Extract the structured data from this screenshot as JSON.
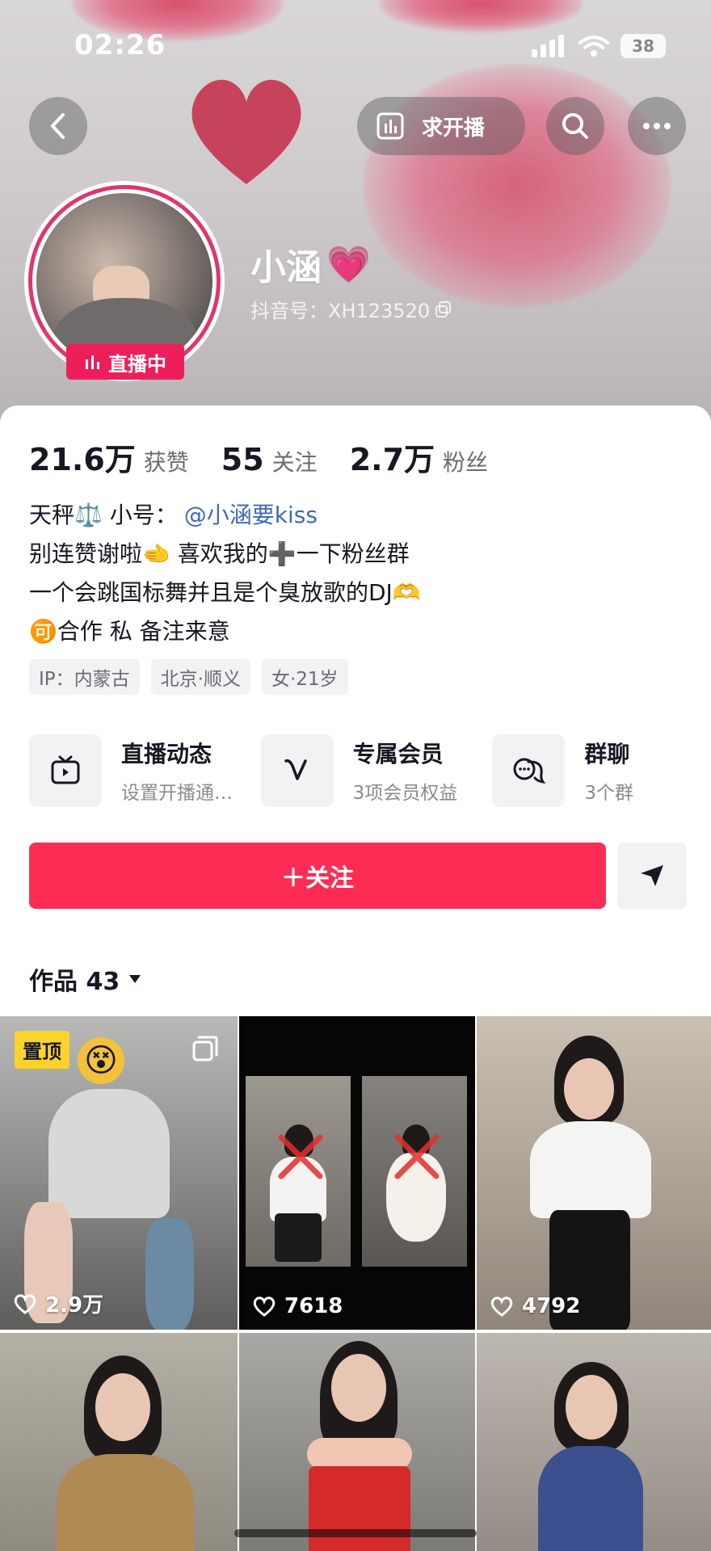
{
  "status_bar": {
    "time": "02:26",
    "battery": "38"
  },
  "header": {
    "request_live_label": "求开播",
    "name": "小涵",
    "name_emoji": "💗",
    "douyin_id": "抖音号：XH123520",
    "live_badge": "直播中"
  },
  "stats": [
    {
      "value": "21.6万",
      "label": "获赞"
    },
    {
      "value": "55",
      "label": "关注"
    },
    {
      "value": "2.7万",
      "label": "粉丝"
    }
  ],
  "bio": {
    "line1_prefix": "天秤⚖️ 小号：",
    "line1_mention": "@小涵要kiss",
    "line2": "别连赞谢啦🫲 喜欢我的➕一下粉丝群",
    "line3": "一个会跳国标舞并且是个臭放歌的DJ🫶",
    "line4": "🉑合作 私 备注来意"
  },
  "tags": [
    "IP：内蒙古",
    "北京·顺义",
    "女·21岁"
  ],
  "features": [
    {
      "title": "直播动态",
      "subtitle": "设置开播通…",
      "icon": "tv-icon"
    },
    {
      "title": "专属会员",
      "subtitle": "3项会员权益",
      "icon": "v-icon"
    },
    {
      "title": "群聊",
      "subtitle": "3个群",
      "icon": "chat-bubbles-icon"
    }
  ],
  "follow_label": "＋关注",
  "works": {
    "label": "作品 43"
  },
  "grid": [
    {
      "likes": "2.9万",
      "pinned": "置顶"
    },
    {
      "likes": "7618"
    },
    {
      "likes": "4792"
    },
    {
      "likes": ""
    },
    {
      "likes": ""
    },
    {
      "likes": ""
    }
  ],
  "colors": {
    "accent": "#fe2c55",
    "live": "#ee1e5b",
    "mention": "#3f69b8",
    "pin": "#fcd32b"
  }
}
